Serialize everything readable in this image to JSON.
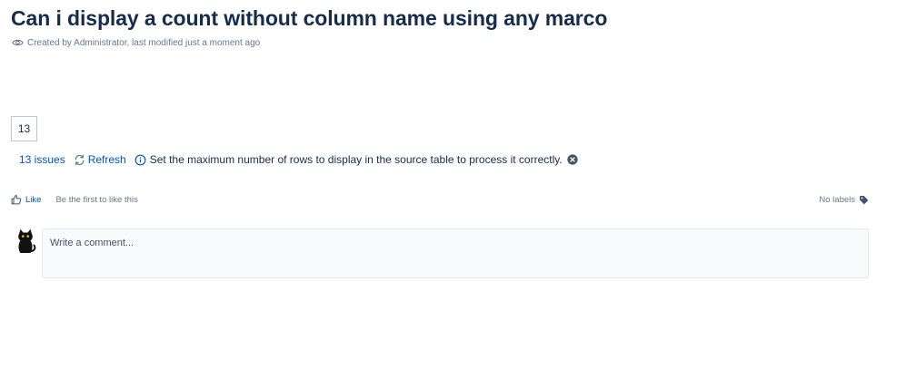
{
  "page": {
    "title": "Can i display a count without column name using any marco",
    "byline": "Created by Administrator, last modified just a moment ago"
  },
  "macro": {
    "count_value": "13"
  },
  "jira": {
    "issues_link": "13 issues",
    "refresh_label": "Refresh",
    "info_message": "Set the maximum number of rows to display in the source table to process it correctly."
  },
  "likes": {
    "like_label": "Like",
    "hint": "Be the first to like this",
    "labels_text": "No labels"
  },
  "comment": {
    "placeholder": "Write a comment..."
  },
  "icons": {
    "eye": "eye-icon",
    "refresh": "refresh-icon",
    "info": "info-icon",
    "close": "close-icon",
    "thumbs_up": "thumbs-up-icon",
    "tag": "tag-icon",
    "avatar": "black-cat-avatar"
  },
  "colors": {
    "link": "#0052cc",
    "text": "#172b4d",
    "muted": "#6b778c",
    "comment_bg": "#f9fafb"
  }
}
